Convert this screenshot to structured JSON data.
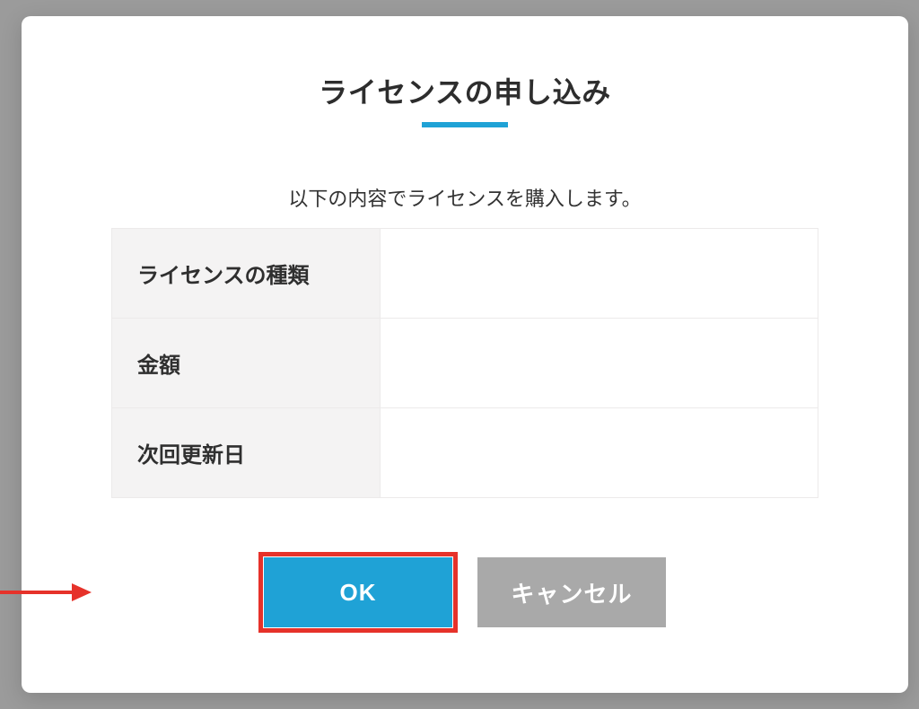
{
  "modal": {
    "title": "ライセンスの申し込み",
    "subtitle": "以下の内容でライセンスを購入します。",
    "rows": [
      {
        "label": "ライセンスの種類",
        "value": ""
      },
      {
        "label": "金額",
        "value": ""
      },
      {
        "label": "次回更新日",
        "value": ""
      }
    ],
    "buttons": {
      "ok": "OK",
      "cancel": "キャンセル"
    }
  },
  "annotation": {
    "highlight_target": "ok-button",
    "arrow_color": "#e6322a"
  }
}
